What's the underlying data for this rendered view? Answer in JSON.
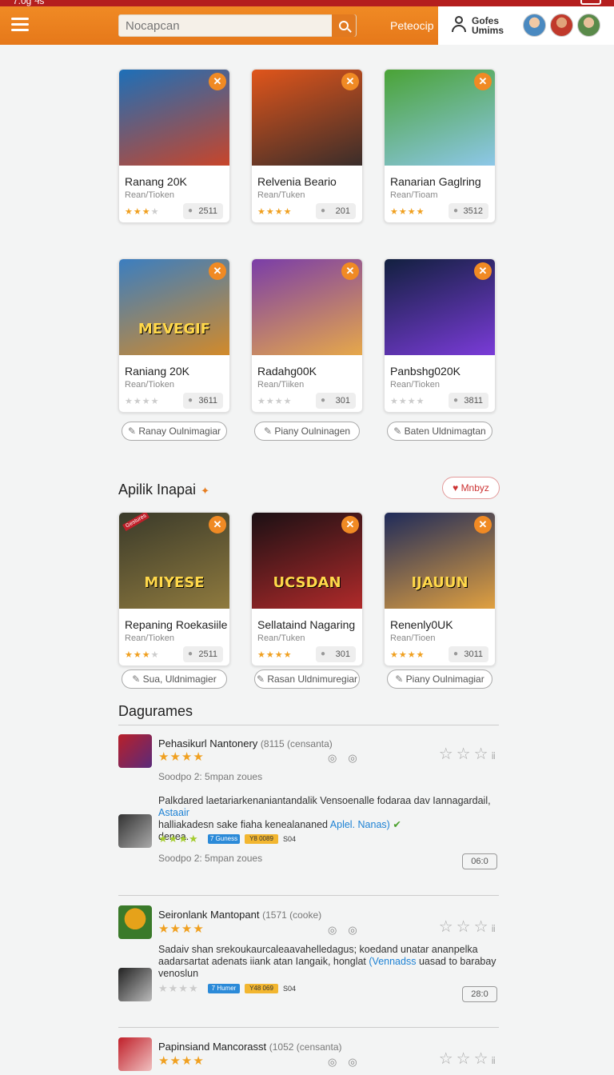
{
  "status": {
    "time": "7:0g ¹łs"
  },
  "header": {
    "search_placeholder": "Nocapcan",
    "link_label": "Peteocip",
    "user_label_1": "Gofes",
    "user_label_2": "Umims"
  },
  "games": [
    {
      "title": "Ranang 20K",
      "sub": "Rean/Tioken",
      "count": "2511",
      "rating": 3,
      "colors": [
        "#1d6fb8",
        "#c8452a"
      ]
    },
    {
      "title": "Relvenia Beario",
      "sub": "Rean/Tuken",
      "count": "201",
      "rating": 4,
      "colors": [
        "#e0551b",
        "#3a2d2a"
      ]
    },
    {
      "title": "Ranarian Gaglring",
      "sub": "Rean/Tioam",
      "count": "3512",
      "rating": 4,
      "colors": [
        "#4aa336",
        "#8dc7e8"
      ]
    },
    {
      "title": "Raniang 20K",
      "sub": "Rean/Tioken",
      "count": "3611",
      "rating": 0,
      "colors": [
        "#3b7ec0",
        "#d28a2a"
      ],
      "art_text": "MEVEGIF"
    },
    {
      "title": "Radahg00K",
      "sub": "Rean/Tiiken",
      "count": "301",
      "rating": 0,
      "colors": [
        "#7a3da8",
        "#e6a84a"
      ]
    },
    {
      "title": "Panbshg020K",
      "sub": "Rean/Tioken",
      "count": "3811",
      "rating": 0,
      "colors": [
        "#12203f",
        "#7a3bd8"
      ]
    }
  ],
  "pills_row1": [
    "Ranay Oulnimagiar",
    "Piany Oulninagen",
    "Baten Uldnimagtan"
  ],
  "section_apps": {
    "title": "Apilik Inapai",
    "more_label": "Mnbyz"
  },
  "apps": [
    {
      "title": "Repaning Roekasiile",
      "sub": "Rean/Tioken",
      "count": "2511",
      "rating": 3,
      "colors": [
        "#3a3a2a",
        "#8f7a3e"
      ],
      "art_text": "MIYESE",
      "badge": "Gestures"
    },
    {
      "title": "Sellataind Nagaring",
      "sub": "Rean/Tuken",
      "count": "301",
      "rating": 4,
      "colors": [
        "#1b1014",
        "#b02a2a"
      ],
      "art_text": "UCSDAN"
    },
    {
      "title": "Renenly0UK",
      "sub": "Rean/Tioen",
      "count": "3011",
      "rating": 4,
      "colors": [
        "#1f2b5a",
        "#e0a040"
      ],
      "art_text": "IJAUUN"
    }
  ],
  "pills_row2": [
    "Sua, Uldnimagier",
    "Rasan Uldnimuregiar",
    "Piany Oulnimagiar"
  ],
  "section_reviews": {
    "title": "Dagurames"
  },
  "reviews": [
    {
      "title": "Pehasikurl Nantonery",
      "meta": "(8115 (censanta)",
      "small": "Soodpo 2: 5mpan zoues",
      "body": "Palkdared laetariarkenaniantandalik Vensoenalle fodaraa dav Iannagardail,",
      "body_link": "Astaair",
      "body2": "halliakadesn sake fiaha kenealananed",
      "body_link2": "Aplel. Nanas)",
      "body3": "denea.",
      "tag1": "7 Guness",
      "tag2": "Y8 0089",
      "tag3": "S04",
      "small2": "Soodpo 2: 5mpan zoues",
      "counter": "06:0",
      "thumb_colors": [
        "#b8202a",
        "#5a2a7a"
      ],
      "thumb2_colors": [
        "#333",
        "#aaa"
      ]
    },
    {
      "title": "Seironlank Mantopant",
      "meta": "(1571 (cooke)",
      "body": "Sadaiv shan srekoukaurcaleaavahelledagus; koedand unatar ananpelka",
      "body2": "aadarsartat adenats iiank atan Iangaik, honglat",
      "body_link2": "(Vennadss",
      "body3": "uasad to barabay",
      "body4": "venoslun",
      "tag1": "7 Humer",
      "tag2": "Y48 069",
      "tag3": "S04",
      "counter": "28:0",
      "thumb_colors": [
        "#e6a21a",
        "#3a7a2a"
      ],
      "thumb2_colors": [
        "#222",
        "#bbb"
      ]
    },
    {
      "title": "Papinsiand Mancorasst",
      "meta": "(1052 (censanta)",
      "thumb_colors": [
        "#c0202a",
        "#f0c0c0"
      ]
    }
  ]
}
